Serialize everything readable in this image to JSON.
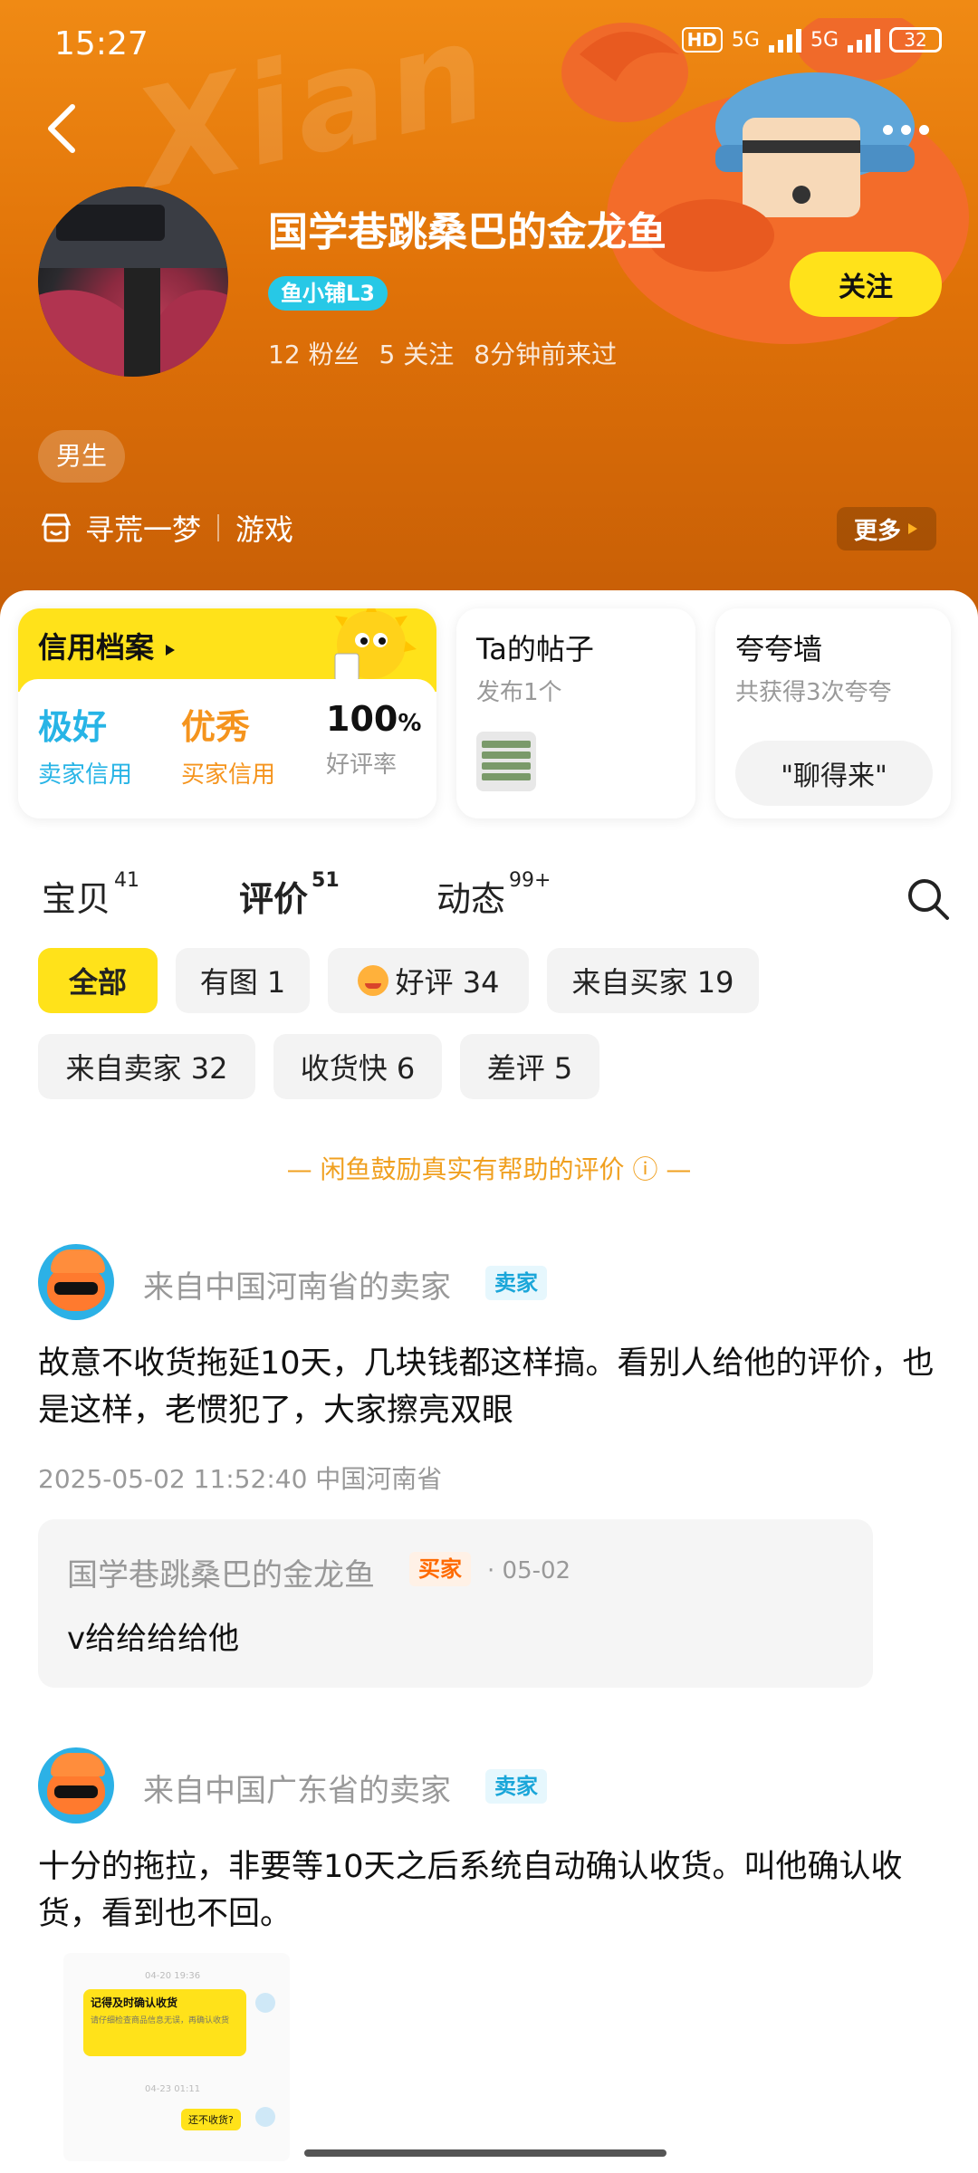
{
  "status_bar": {
    "time": "15:27",
    "network1": "5G",
    "network2": "5G",
    "hd": "HD",
    "battery": "32"
  },
  "header": {
    "shop_name": "国学巷跳桑巴的金龙鱼",
    "level_badge": "鱼小铺L3",
    "stats": {
      "fans": "12 粉丝",
      "following": "5 关注",
      "last_seen": "8分钟前来过"
    },
    "follow_label": "关注",
    "gender_tag": "男生",
    "game_name": "寻荒一梦",
    "category": "游戏",
    "more_label": "更多",
    "bg_logo": "Xian"
  },
  "credit_card": {
    "title": "信用档案",
    "seller_credit": {
      "value": "极好",
      "label": "卖家信用"
    },
    "buyer_credit": {
      "value": "优秀",
      "label": "买家信用"
    },
    "rate": {
      "value": "100",
      "unit": "%",
      "label": "好评率"
    }
  },
  "posts_card": {
    "title": "Ta的帖子",
    "subtitle": "发布1个"
  },
  "praise_card": {
    "title": "夸夸墙",
    "subtitle": "共获得3次夸夸",
    "chip": "\"聊得来\""
  },
  "tabs": [
    {
      "label": "宝贝",
      "count": "41",
      "active": false
    },
    {
      "label": "评价",
      "count": "51",
      "active": true
    },
    {
      "label": "动态",
      "count": "99+",
      "active": false
    }
  ],
  "filters": [
    {
      "label": "全部",
      "active": true
    },
    {
      "label": "有图 1"
    },
    {
      "label": "好评 34"
    },
    {
      "label": "来自买家 19"
    },
    {
      "label": "来自卖家 32"
    },
    {
      "label": "收货快 6"
    },
    {
      "label": "差评 5"
    }
  ],
  "notice": "— 闲鱼鼓励真实有帮助的评价 ⓘ —",
  "reviews": [
    {
      "from": "来自中国河南省的卖家",
      "badge": "卖家",
      "text": "故意不收货拖延10天，几块钱都这样搞。看别人给他的评价，也是这样，老惯犯了，大家擦亮双眼",
      "meta": "2025-05-02 11:52:40  中国河南省",
      "reply": {
        "name": "国学巷跳桑巴的金龙鱼",
        "badge": "买家",
        "date": "· 05-02",
        "text": "v给给给给他"
      }
    },
    {
      "from": "来自中国广东省的卖家",
      "badge": "卖家",
      "text": "十分的拖拉，非要等10天之后系统自动确认收货。叫他确认收货，看到也不回。",
      "image": {
        "time1": "04-20 19:36",
        "bubble_title": "记得及时确认收货",
        "bubble_text": "请仔细检查商品信息无误，再确认收货",
        "time2": "04-23 01:11",
        "reply": "还不收货?"
      }
    }
  ],
  "colors": {
    "brand_yellow": "#ffe21a",
    "header_orange": "#e07208",
    "seller_blue": "#1aa6d9",
    "buyer_orange": "#ff6a00",
    "notice": "#f0a020"
  }
}
